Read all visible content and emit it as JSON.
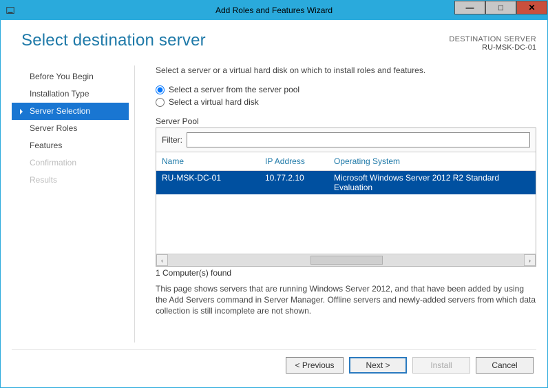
{
  "window": {
    "title": "Add Roles and Features Wizard"
  },
  "header": {
    "page_title": "Select destination server",
    "dest_label": "DESTINATION SERVER",
    "dest_value": "RU-MSK-DC-01"
  },
  "nav": {
    "items": [
      {
        "label": "Before You Begin",
        "state": "normal"
      },
      {
        "label": "Installation Type",
        "state": "normal"
      },
      {
        "label": "Server Selection",
        "state": "selected"
      },
      {
        "label": "Server Roles",
        "state": "normal"
      },
      {
        "label": "Features",
        "state": "normal"
      },
      {
        "label": "Confirmation",
        "state": "disabled"
      },
      {
        "label": "Results",
        "state": "disabled"
      }
    ]
  },
  "main": {
    "instruction": "Select a server or a virtual hard disk on which to install roles and features.",
    "radios": {
      "pool": "Select a server from the server pool",
      "vhd": "Select a virtual hard disk",
      "selected": "pool"
    },
    "pool_label": "Server Pool",
    "filter_label": "Filter:",
    "filter_value": "",
    "columns": {
      "name": "Name",
      "ip": "IP Address",
      "os": "Operating System"
    },
    "rows": [
      {
        "name": "RU-MSK-DC-01",
        "ip": "10.77.2.10",
        "os": "Microsoft Windows Server 2012 R2 Standard Evaluation",
        "selected": true
      }
    ],
    "found_text": "1 Computer(s) found",
    "description": "This page shows servers that are running Windows Server 2012, and that have been added by using the Add Servers command in Server Manager. Offline servers and newly-added servers from which data collection is still incomplete are not shown."
  },
  "buttons": {
    "previous": "< Previous",
    "next": "Next >",
    "install": "Install",
    "cancel": "Cancel"
  }
}
